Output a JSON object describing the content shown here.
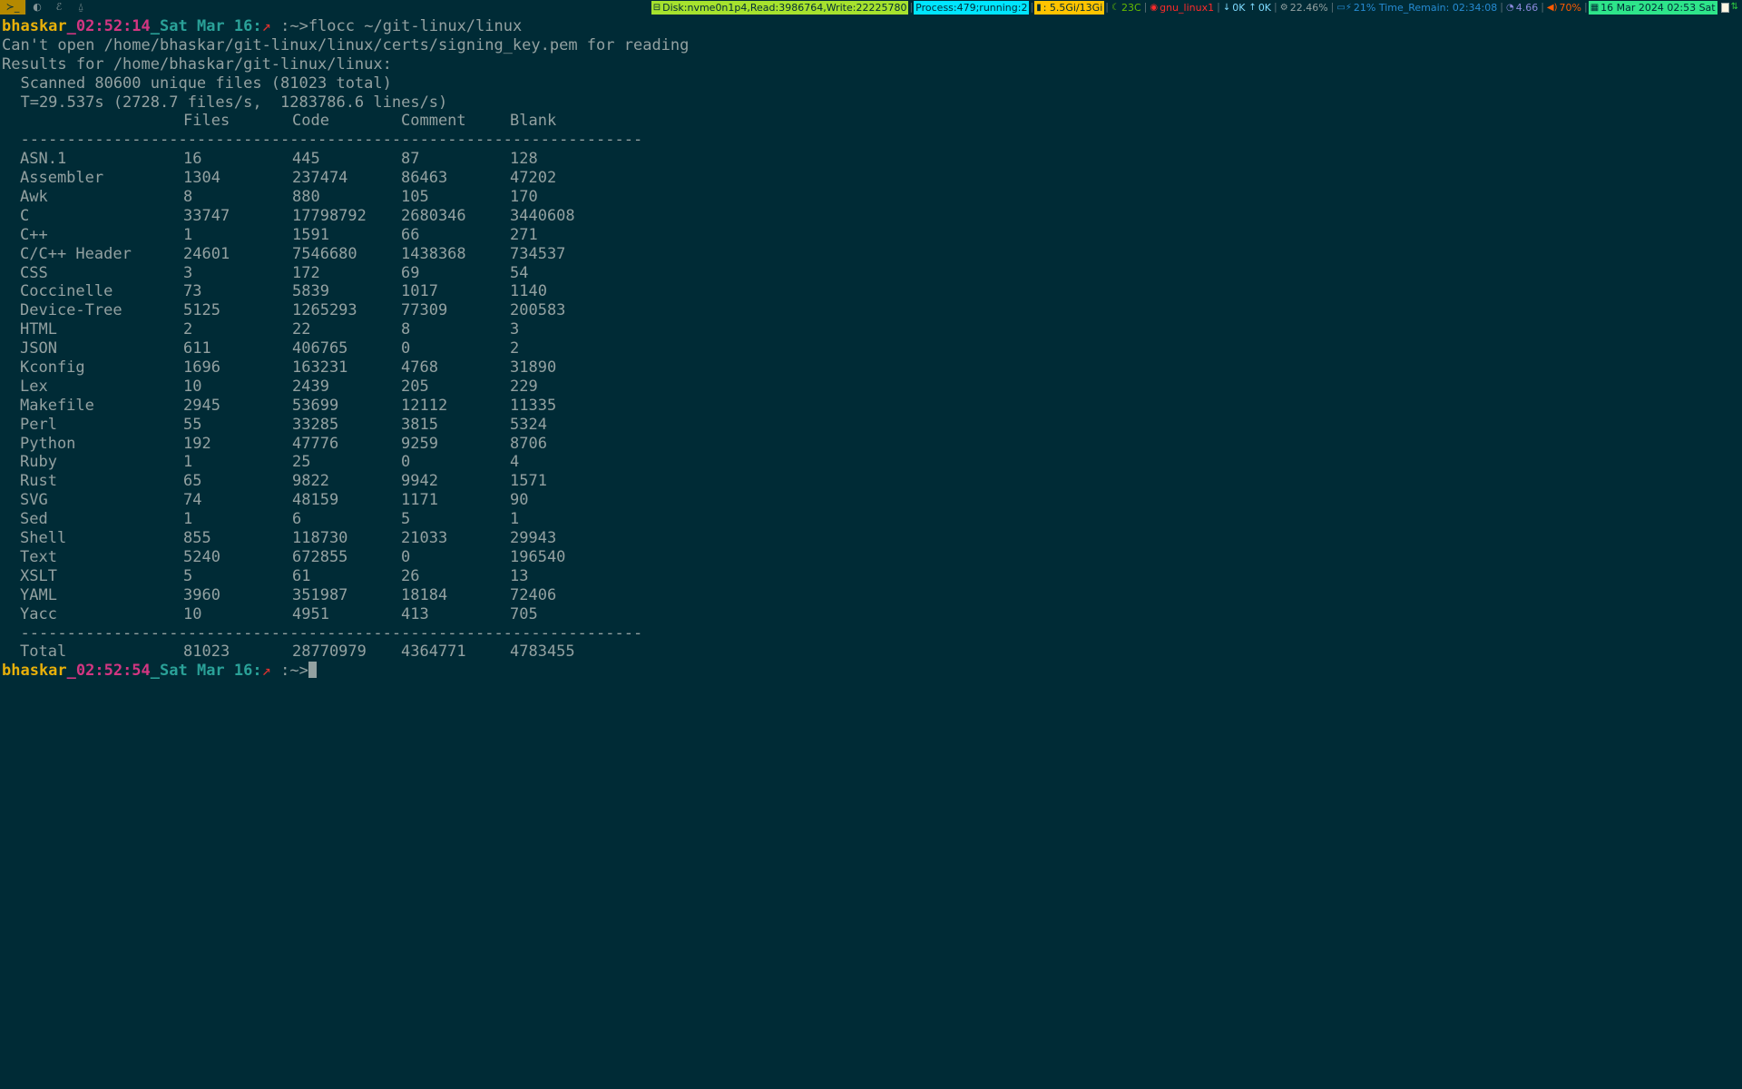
{
  "topbar": {
    "workspaces": [
      {
        "label": "≻_",
        "icon": "terminal-icon",
        "active": true
      },
      {
        "label": "◐",
        "icon": "browser-icon",
        "active": false
      },
      {
        "label": "ℰ",
        "icon": "editor-icon",
        "active": false
      },
      {
        "label": "⍙",
        "icon": "linux-icon",
        "active": false
      }
    ],
    "disk": "Disk:nvme0n1p4,Read:3986764,Write:22225780",
    "process": "Process:479;running:2",
    "memory": ": 5.5Gi/13Gi",
    "temp": "23C",
    "net_iface": "gnu_linux1",
    "down": "0K",
    "up": "0K",
    "cpu": "22.46%",
    "battery": "21% Time_Remain: 02:34:08",
    "load": "4.66",
    "volume": "70%",
    "datetime": "16 Mar 2024 02:53 Sat"
  },
  "terminal": {
    "prompt1": {
      "user": "bhaskar",
      "time": "_02:52:14",
      "date": "_Sat Mar 16:",
      "arrow": "↗",
      "dir": " :~>",
      "command": "flocc ~/git-linux/linux"
    },
    "error_line": "Can't open /home/bhaskar/git-linux/linux/certs/signing_key.pem for reading",
    "results_line": "Results for /home/bhaskar/git-linux/linux:",
    "scanned_line": "  Scanned 80600 unique files (81023 total)",
    "timing_line": "  T=29.537s (2728.7 files/s,  1283786.6 lines/s)",
    "headers": [
      "",
      "Files",
      "Code",
      "Comment",
      "Blank"
    ],
    "divider": "  -------------------------------------------------------------------",
    "rows": [
      [
        "ASN.1",
        "16",
        "445",
        "87",
        "128"
      ],
      [
        "Assembler",
        "1304",
        "237474",
        "86463",
        "47202"
      ],
      [
        "Awk",
        "8",
        "880",
        "105",
        "170"
      ],
      [
        "C",
        "33747",
        "17798792",
        "2680346",
        "3440608"
      ],
      [
        "C++",
        "1",
        "1591",
        "66",
        "271"
      ],
      [
        "C/C++ Header",
        "24601",
        "7546680",
        "1438368",
        "734537"
      ],
      [
        "CSS",
        "3",
        "172",
        "69",
        "54"
      ],
      [
        "Coccinelle",
        "73",
        "5839",
        "1017",
        "1140"
      ],
      [
        "Device-Tree",
        "5125",
        "1265293",
        "77309",
        "200583"
      ],
      [
        "HTML",
        "2",
        "22",
        "8",
        "3"
      ],
      [
        "JSON",
        "611",
        "406765",
        "0",
        "2"
      ],
      [
        "Kconfig",
        "1696",
        "163231",
        "4768",
        "31890"
      ],
      [
        "Lex",
        "10",
        "2439",
        "205",
        "229"
      ],
      [
        "Makefile",
        "2945",
        "53699",
        "12112",
        "11335"
      ],
      [
        "Perl",
        "55",
        "33285",
        "3815",
        "5324"
      ],
      [
        "Python",
        "192",
        "47776",
        "9259",
        "8706"
      ],
      [
        "Ruby",
        "1",
        "25",
        "0",
        "4"
      ],
      [
        "Rust",
        "65",
        "9822",
        "9942",
        "1571"
      ],
      [
        "SVG",
        "74",
        "48159",
        "1171",
        "90"
      ],
      [
        "Sed",
        "1",
        "6",
        "5",
        "1"
      ],
      [
        "Shell",
        "855",
        "118730",
        "21033",
        "29943"
      ],
      [
        "Text",
        "5240",
        "672855",
        "0",
        "196540"
      ],
      [
        "XSLT",
        "5",
        "61",
        "26",
        "13"
      ],
      [
        "YAML",
        "3960",
        "351987",
        "18184",
        "72406"
      ],
      [
        "Yacc",
        "10",
        "4951",
        "413",
        "705"
      ]
    ],
    "total": [
      "Total",
      "81023",
      "28770979",
      "4364771",
      "4783455"
    ],
    "prompt2": {
      "user": "bhaskar",
      "time": "_02:52:54",
      "date": "_Sat Mar 16:",
      "arrow": "↗",
      "dir": " :~>"
    }
  }
}
